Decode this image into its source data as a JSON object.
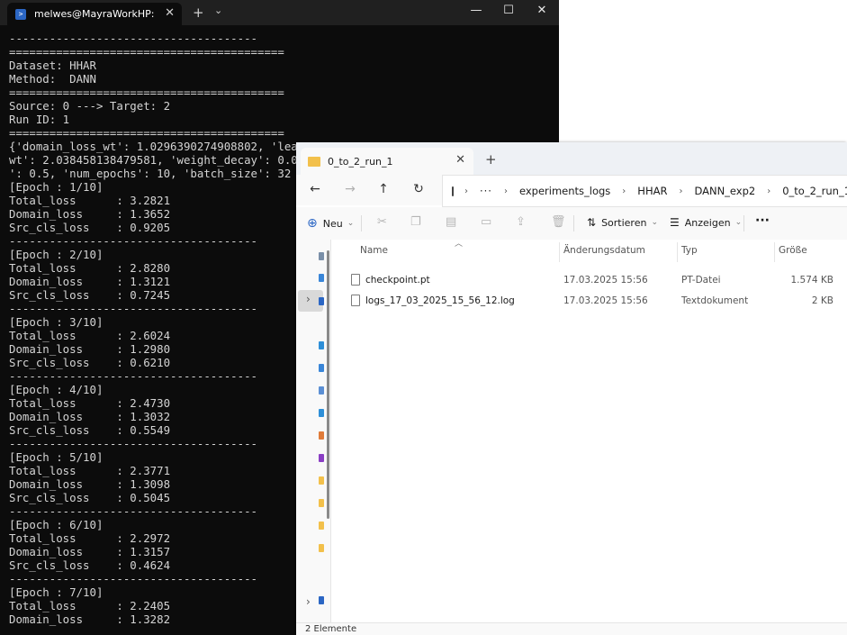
{
  "terminal": {
    "tab_title": "melwes@MayraWorkHP: /mn",
    "lines": [
      "-------------------------------------",
      "=========================================",
      "Dataset: HHAR",
      "Method:  DANN",
      "=========================================",
      "Source: 0 ---> Target: 2",
      "Run ID: 1",
      "=========================================",
      "{'domain_loss_wt': 1.0296390274908802, 'lea",
      "wt': 2.038458138479581, 'weight_decay': 0.0",
      "': 0.5, 'num_epochs': 10, 'batch_size': 32",
      "[Epoch : 1/10]",
      "Total_loss      : 3.2821",
      "Domain_loss     : 1.3652",
      "Src_cls_loss    : 0.9205",
      "-------------------------------------",
      "[Epoch : 2/10]",
      "Total_loss      : 2.8280",
      "Domain_loss     : 1.3121",
      "Src_cls_loss    : 0.7245",
      "-------------------------------------",
      "[Epoch : 3/10]",
      "Total_loss      : 2.6024",
      "Domain_loss     : 1.2980",
      "Src_cls_loss    : 0.6210",
      "-------------------------------------",
      "[Epoch : 4/10]",
      "Total_loss      : 2.4730",
      "Domain_loss     : 1.3032",
      "Src_cls_loss    : 0.5549",
      "-------------------------------------",
      "[Epoch : 5/10]",
      "Total_loss      : 2.3771",
      "Domain_loss     : 1.3098",
      "Src_cls_loss    : 0.5045",
      "-------------------------------------",
      "[Epoch : 6/10]",
      "Total_loss      : 2.2972",
      "Domain_loss     : 1.3157",
      "Src_cls_loss    : 0.4624",
      "-------------------------------------",
      "[Epoch : 7/10]",
      "Total_loss      : 2.2405",
      "Domain_loss     : 1.3282"
    ]
  },
  "explorer": {
    "tab_title": "0_to_2_run_1",
    "breadcrumbs": [
      "experiments_logs",
      "HHAR",
      "DANN_exp2",
      "0_to_2_run_1"
    ],
    "toolbar": {
      "new_label": "Neu",
      "sort_label": "Sortieren",
      "view_label": "Anzeigen",
      "more_label": "···"
    },
    "columns": {
      "name": "Name",
      "modified": "Änderungsdatum",
      "type": "Typ",
      "size": "Größe"
    },
    "files": [
      {
        "name": "checkpoint.pt",
        "modified": "17.03.2025 15:56",
        "type": "PT-Datei",
        "size": "1.574 KB"
      },
      {
        "name": "logs_17_03_2025_15_56_12.log",
        "modified": "17.03.2025 15:56",
        "type": "Textdokument",
        "size": "2 KB"
      }
    ],
    "status": "2 Elemente"
  },
  "colors": {
    "terminal_bg": "#0c0c0c",
    "terminal_fg": "#d4d4d4",
    "folder": "#f2c04b"
  }
}
